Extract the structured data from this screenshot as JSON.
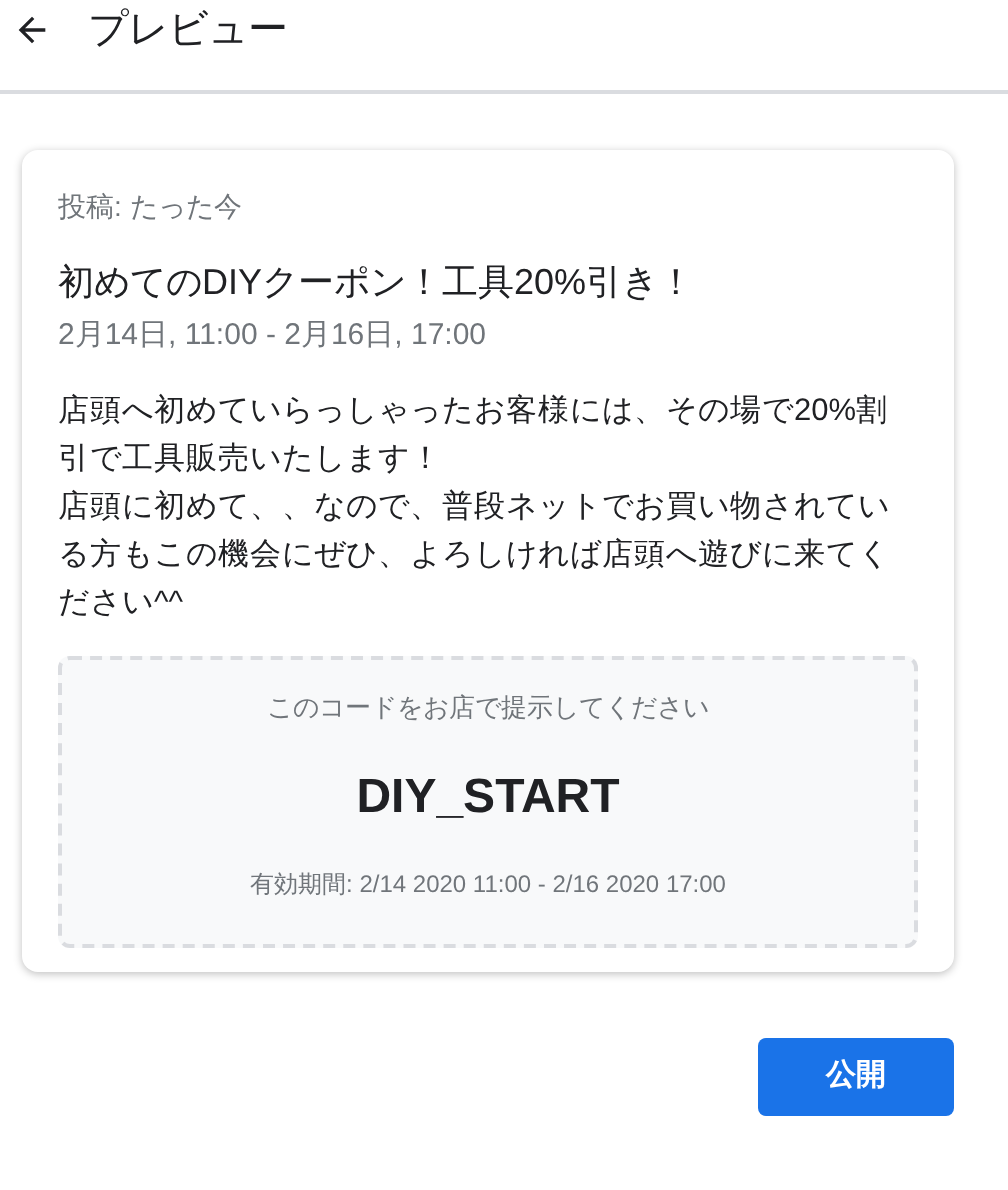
{
  "header": {
    "title": "プレビュー"
  },
  "post": {
    "posted": "投稿: たった今",
    "title": "初めてのDIYクーポン！工具20%引き！",
    "period": "2月14日, 11:00 - 2月16日, 17:00",
    "body": [
      "店頭へ初めていらっしゃったお客様には、その場で20%割引で工具販売いたします！",
      "店頭に初めて、、なので、普段ネットでお買い物されている方もこの機会にぜひ、よろしければ店頭へ遊びに来てください^^"
    ],
    "coupon": {
      "instruction": "このコードをお店で提示してください",
      "code": "DIY_START",
      "validity": "有効期間: 2/14 2020 11:00 - 2/16 2020 17:00"
    }
  },
  "actions": {
    "publish": "公開"
  }
}
